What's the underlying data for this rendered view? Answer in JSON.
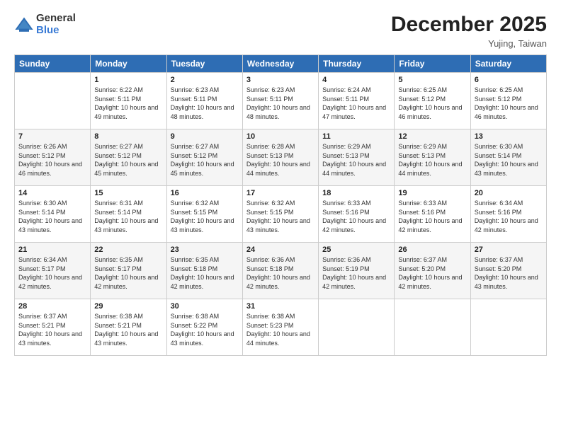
{
  "logo": {
    "general": "General",
    "blue": "Blue"
  },
  "title": "December 2025",
  "location": "Yujing, Taiwan",
  "days_of_week": [
    "Sunday",
    "Monday",
    "Tuesday",
    "Wednesday",
    "Thursday",
    "Friday",
    "Saturday"
  ],
  "weeks": [
    [
      {
        "day": "",
        "sunrise": "",
        "sunset": "",
        "daylight": ""
      },
      {
        "day": "1",
        "sunrise": "Sunrise: 6:22 AM",
        "sunset": "Sunset: 5:11 PM",
        "daylight": "Daylight: 10 hours and 49 minutes."
      },
      {
        "day": "2",
        "sunrise": "Sunrise: 6:23 AM",
        "sunset": "Sunset: 5:11 PM",
        "daylight": "Daylight: 10 hours and 48 minutes."
      },
      {
        "day": "3",
        "sunrise": "Sunrise: 6:23 AM",
        "sunset": "Sunset: 5:11 PM",
        "daylight": "Daylight: 10 hours and 48 minutes."
      },
      {
        "day": "4",
        "sunrise": "Sunrise: 6:24 AM",
        "sunset": "Sunset: 5:11 PM",
        "daylight": "Daylight: 10 hours and 47 minutes."
      },
      {
        "day": "5",
        "sunrise": "Sunrise: 6:25 AM",
        "sunset": "Sunset: 5:12 PM",
        "daylight": "Daylight: 10 hours and 46 minutes."
      },
      {
        "day": "6",
        "sunrise": "Sunrise: 6:25 AM",
        "sunset": "Sunset: 5:12 PM",
        "daylight": "Daylight: 10 hours and 46 minutes."
      }
    ],
    [
      {
        "day": "7",
        "sunrise": "Sunrise: 6:26 AM",
        "sunset": "Sunset: 5:12 PM",
        "daylight": "Daylight: 10 hours and 46 minutes."
      },
      {
        "day": "8",
        "sunrise": "Sunrise: 6:27 AM",
        "sunset": "Sunset: 5:12 PM",
        "daylight": "Daylight: 10 hours and 45 minutes."
      },
      {
        "day": "9",
        "sunrise": "Sunrise: 6:27 AM",
        "sunset": "Sunset: 5:12 PM",
        "daylight": "Daylight: 10 hours and 45 minutes."
      },
      {
        "day": "10",
        "sunrise": "Sunrise: 6:28 AM",
        "sunset": "Sunset: 5:13 PM",
        "daylight": "Daylight: 10 hours and 44 minutes."
      },
      {
        "day": "11",
        "sunrise": "Sunrise: 6:29 AM",
        "sunset": "Sunset: 5:13 PM",
        "daylight": "Daylight: 10 hours and 44 minutes."
      },
      {
        "day": "12",
        "sunrise": "Sunrise: 6:29 AM",
        "sunset": "Sunset: 5:13 PM",
        "daylight": "Daylight: 10 hours and 44 minutes."
      },
      {
        "day": "13",
        "sunrise": "Sunrise: 6:30 AM",
        "sunset": "Sunset: 5:14 PM",
        "daylight": "Daylight: 10 hours and 43 minutes."
      }
    ],
    [
      {
        "day": "14",
        "sunrise": "Sunrise: 6:30 AM",
        "sunset": "Sunset: 5:14 PM",
        "daylight": "Daylight: 10 hours and 43 minutes."
      },
      {
        "day": "15",
        "sunrise": "Sunrise: 6:31 AM",
        "sunset": "Sunset: 5:14 PM",
        "daylight": "Daylight: 10 hours and 43 minutes."
      },
      {
        "day": "16",
        "sunrise": "Sunrise: 6:32 AM",
        "sunset": "Sunset: 5:15 PM",
        "daylight": "Daylight: 10 hours and 43 minutes."
      },
      {
        "day": "17",
        "sunrise": "Sunrise: 6:32 AM",
        "sunset": "Sunset: 5:15 PM",
        "daylight": "Daylight: 10 hours and 43 minutes."
      },
      {
        "day": "18",
        "sunrise": "Sunrise: 6:33 AM",
        "sunset": "Sunset: 5:16 PM",
        "daylight": "Daylight: 10 hours and 42 minutes."
      },
      {
        "day": "19",
        "sunrise": "Sunrise: 6:33 AM",
        "sunset": "Sunset: 5:16 PM",
        "daylight": "Daylight: 10 hours and 42 minutes."
      },
      {
        "day": "20",
        "sunrise": "Sunrise: 6:34 AM",
        "sunset": "Sunset: 5:16 PM",
        "daylight": "Daylight: 10 hours and 42 minutes."
      }
    ],
    [
      {
        "day": "21",
        "sunrise": "Sunrise: 6:34 AM",
        "sunset": "Sunset: 5:17 PM",
        "daylight": "Daylight: 10 hours and 42 minutes."
      },
      {
        "day": "22",
        "sunrise": "Sunrise: 6:35 AM",
        "sunset": "Sunset: 5:17 PM",
        "daylight": "Daylight: 10 hours and 42 minutes."
      },
      {
        "day": "23",
        "sunrise": "Sunrise: 6:35 AM",
        "sunset": "Sunset: 5:18 PM",
        "daylight": "Daylight: 10 hours and 42 minutes."
      },
      {
        "day": "24",
        "sunrise": "Sunrise: 6:36 AM",
        "sunset": "Sunset: 5:18 PM",
        "daylight": "Daylight: 10 hours and 42 minutes."
      },
      {
        "day": "25",
        "sunrise": "Sunrise: 6:36 AM",
        "sunset": "Sunset: 5:19 PM",
        "daylight": "Daylight: 10 hours and 42 minutes."
      },
      {
        "day": "26",
        "sunrise": "Sunrise: 6:37 AM",
        "sunset": "Sunset: 5:20 PM",
        "daylight": "Daylight: 10 hours and 42 minutes."
      },
      {
        "day": "27",
        "sunrise": "Sunrise: 6:37 AM",
        "sunset": "Sunset: 5:20 PM",
        "daylight": "Daylight: 10 hours and 43 minutes."
      }
    ],
    [
      {
        "day": "28",
        "sunrise": "Sunrise: 6:37 AM",
        "sunset": "Sunset: 5:21 PM",
        "daylight": "Daylight: 10 hours and 43 minutes."
      },
      {
        "day": "29",
        "sunrise": "Sunrise: 6:38 AM",
        "sunset": "Sunset: 5:21 PM",
        "daylight": "Daylight: 10 hours and 43 minutes."
      },
      {
        "day": "30",
        "sunrise": "Sunrise: 6:38 AM",
        "sunset": "Sunset: 5:22 PM",
        "daylight": "Daylight: 10 hours and 43 minutes."
      },
      {
        "day": "31",
        "sunrise": "Sunrise: 6:38 AM",
        "sunset": "Sunset: 5:23 PM",
        "daylight": "Daylight: 10 hours and 44 minutes."
      },
      {
        "day": "",
        "sunrise": "",
        "sunset": "",
        "daylight": ""
      },
      {
        "day": "",
        "sunrise": "",
        "sunset": "",
        "daylight": ""
      },
      {
        "day": "",
        "sunrise": "",
        "sunset": "",
        "daylight": ""
      }
    ]
  ]
}
